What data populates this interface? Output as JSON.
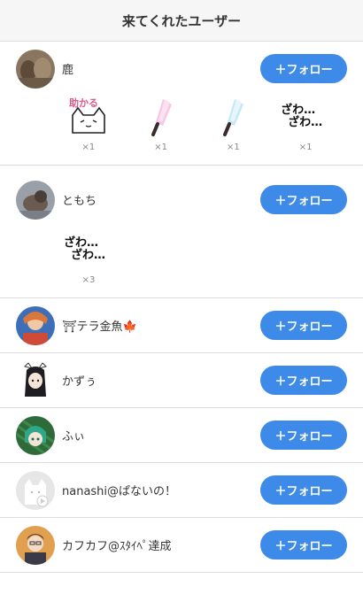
{
  "header": {
    "title": "来てくれたユーザー"
  },
  "follow_label": "＋フォロー",
  "colors": {
    "follow_button": "#3d8ae8",
    "divider": "#dcdcdc",
    "header_bg": "#f6f6f6"
  },
  "users": [
    {
      "name": "鹿",
      "stamps": [
        {
          "icon": "cat-tasukaru-stamp",
          "text": "助かる",
          "count": "×1"
        },
        {
          "icon": "pink-penlight-stamp",
          "count": "×1"
        },
        {
          "icon": "blue-penlight-stamp",
          "count": "×1"
        },
        {
          "icon": "zawa-stamp",
          "line1": "ざわ…",
          "line2": "ざわ…",
          "count": "×1"
        }
      ]
    },
    {
      "name": "ともち",
      "stamps": [
        {
          "icon": "zawa-stamp",
          "line1": "ざわ…",
          "line2": "ざわ…",
          "count": "×3"
        }
      ]
    },
    {
      "name": "⛩テラ金魚🍁"
    },
    {
      "name": "かずぅ"
    },
    {
      "name": "ふぃ"
    },
    {
      "name": "nanashi@ぱないの！"
    },
    {
      "name": "カフカフ@ｽﾀｲﾍﾟ達成"
    }
  ]
}
